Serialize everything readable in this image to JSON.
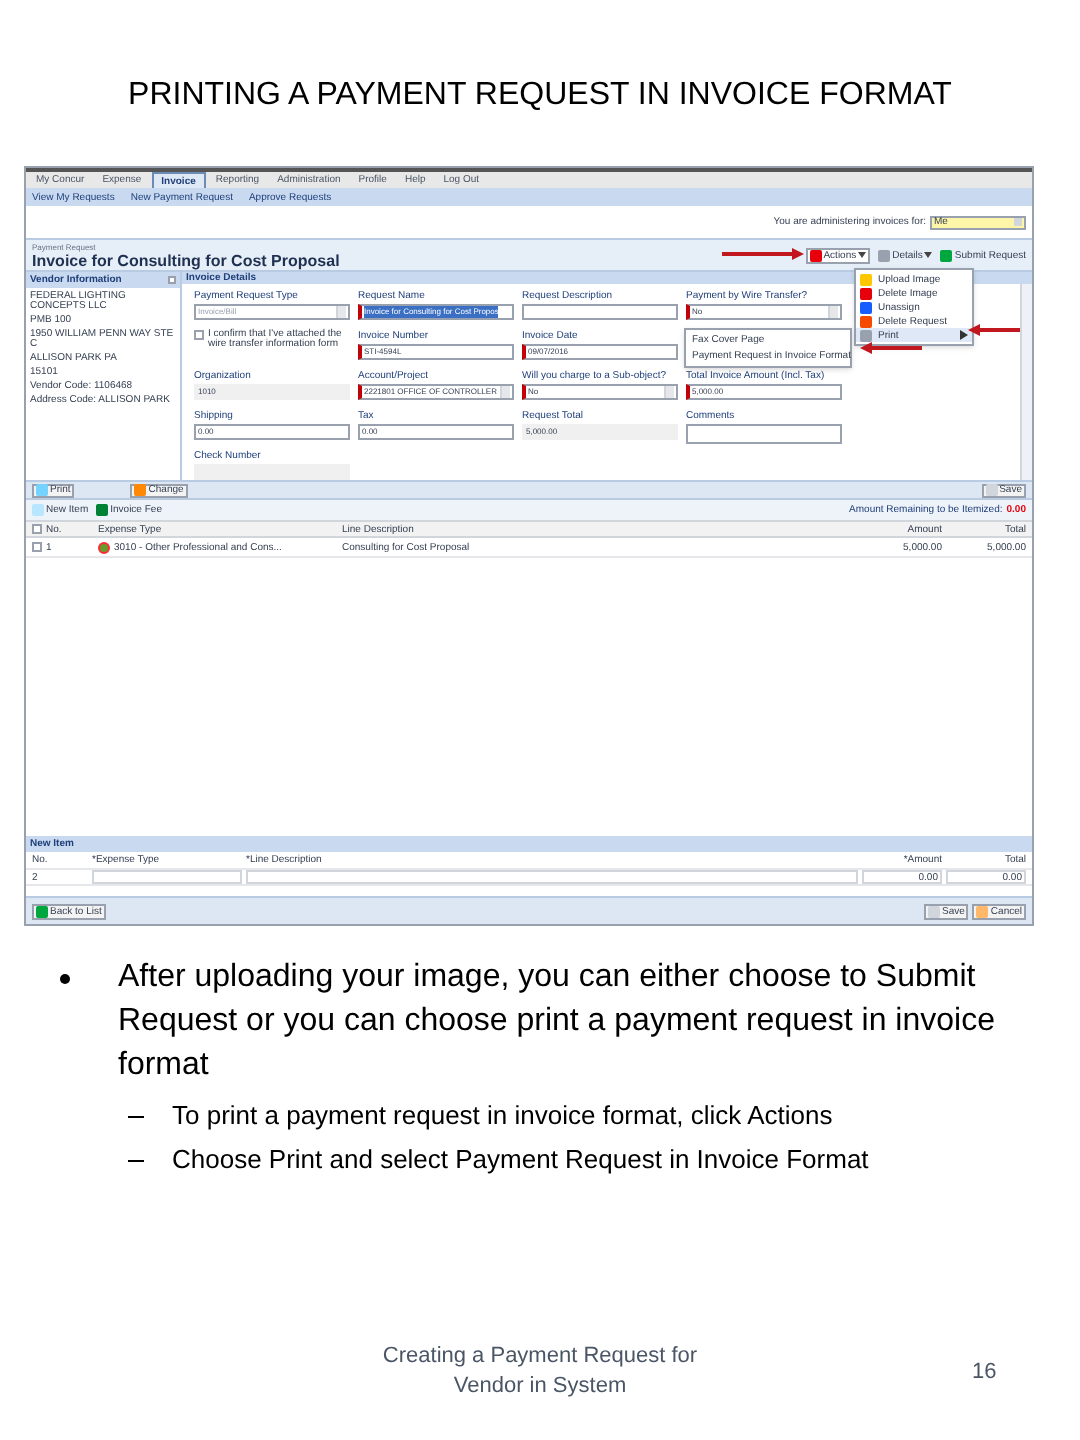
{
  "slide_title": "PRINTING A PAYMENT REQUEST IN INVOICE FORMAT",
  "app": {
    "nav_tabs": [
      {
        "label": "My Concur",
        "selected": false
      },
      {
        "label": "Expense",
        "selected": false
      },
      {
        "label": "Invoice",
        "selected": true
      },
      {
        "label": "Reporting",
        "selected": false
      },
      {
        "label": "Administration",
        "selected": false
      },
      {
        "label": "Profile",
        "selected": false
      },
      {
        "label": "Help",
        "selected": false
      },
      {
        "label": "Log Out",
        "selected": false
      }
    ],
    "sub_nav": [
      "View My Requests",
      "New Payment Request",
      "Approve Requests"
    ],
    "administering": {
      "label": "You are administering invoices for:",
      "value": "Me"
    },
    "page_caption": "Payment Request",
    "page_heading": "Invoice for Consulting for Cost Proposal",
    "toolbar": [
      {
        "label": "Actions",
        "dropdown": true
      },
      {
        "label": "Details",
        "dropdown": true
      },
      {
        "label": "Submit Request",
        "dropdown": false
      }
    ],
    "actions_menu": [
      {
        "label": "Upload Image",
        "has_submenu": false,
        "selected": false
      },
      {
        "label": "Delete Image",
        "has_submenu": false,
        "selected": false
      },
      {
        "label": "Unassign",
        "has_submenu": false,
        "selected": false
      },
      {
        "label": "Delete Request",
        "has_submenu": false,
        "selected": false
      },
      {
        "label": "Print",
        "has_submenu": true,
        "selected": true
      }
    ],
    "print_submenu": [
      "Fax Cover Page",
      "Payment Request in Invoice Format"
    ],
    "vendor": {
      "header": "Vendor Information",
      "lines": [
        "FEDERAL LIGHTING CONCEPTS LLC",
        "PMB 100",
        "1950 WILLIAM PENN WAY STE C",
        "ALLISON PARK PA",
        "15101",
        "Vendor Code: 1106468",
        "Address Code: ALLISON PARK"
      ]
    },
    "invoice_details": {
      "header": "Invoice Details",
      "rows": [
        [
          {
            "kind": "select",
            "label": "Payment Request Type",
            "value": "Invoice/Bill",
            "required": false,
            "disabled": true
          },
          {
            "kind": "text",
            "label": "Request Name",
            "value": "Invoice for Consulting for Cost Propos",
            "required": true,
            "highlighted": true
          },
          {
            "kind": "text",
            "label": "Request Description",
            "required": false
          },
          {
            "kind": "select",
            "label": "Payment by Wire Transfer?",
            "value": "No",
            "required": true
          }
        ],
        [
          {
            "kind": "checkbox",
            "label": "I confirm that I've attached the wire transfer information form",
            "checked": false
          },
          {
            "kind": "text",
            "label": "Invoice Number",
            "value": "STI-4594L",
            "required": true
          },
          {
            "kind": "text",
            "label": "Invoice Date",
            "value": "09/07/2016",
            "required": true
          }
        ],
        [
          {
            "kind": "readonly",
            "label": "Organization",
            "value": "1010"
          },
          {
            "kind": "select",
            "label": "Account/Project",
            "value": "2221801 OFFICE OF CONTROLLER",
            "required": true
          },
          {
            "kind": "select",
            "label": "Will you charge to a Sub-object?",
            "value": "No",
            "required": true
          },
          {
            "kind": "text",
            "label": "Total Invoice Amount (Incl. Tax)",
            "value": "5,000.00",
            "required": true
          }
        ],
        [
          {
            "kind": "text",
            "label": "Shipping",
            "value": "0.00",
            "required": false
          },
          {
            "kind": "text",
            "label": "Tax",
            "value": "0.00",
            "required": false
          },
          {
            "kind": "readonly",
            "label": "Request Total",
            "value": "5,000.00"
          },
          {
            "kind": "textarea",
            "label": "Comments"
          }
        ],
        [
          {
            "kind": "readonly",
            "label": "Check Number"
          }
        ]
      ]
    },
    "form_buttons_left": [
      "Print",
      "Change"
    ],
    "form_button_right": "Save",
    "items_toolbar": [
      "New Item",
      "Invoice Fee"
    ],
    "remaining": {
      "label": "Amount Remaining to be Itemized:",
      "value": "0.00"
    },
    "items_table": {
      "all_checked": false,
      "columns": [
        "No.",
        "Expense Type",
        "Line Description",
        "Amount",
        "Total"
      ],
      "rows": [
        {
          "checked": false,
          "cells": [
            "1",
            "3010 - Other Professional and Cons...",
            "Consulting for Cost Proposal",
            "5,000.00",
            "5,000.00"
          ]
        }
      ]
    },
    "new_item": {
      "header": "New Item",
      "columns": [
        "No.",
        "*Expense Type",
        "*Line Description",
        "*Amount",
        "Total"
      ],
      "row": {
        "no": "2",
        "amount": "0.00",
        "total": "0.00"
      }
    },
    "bottom_left": "Back to List",
    "bottom_right": [
      "Save",
      "Cancel"
    ]
  },
  "bullet": {
    "text": "After uploading your image, you can either choose to Submit Request or you can choose print a payment request in invoice format",
    "sub": [
      "To print a payment request in invoice format, click Actions",
      "Choose Print and select Payment Request in Invoice Format"
    ]
  },
  "footer": {
    "caption": "Creating a Payment Request for Vendor in System",
    "page": "16"
  }
}
